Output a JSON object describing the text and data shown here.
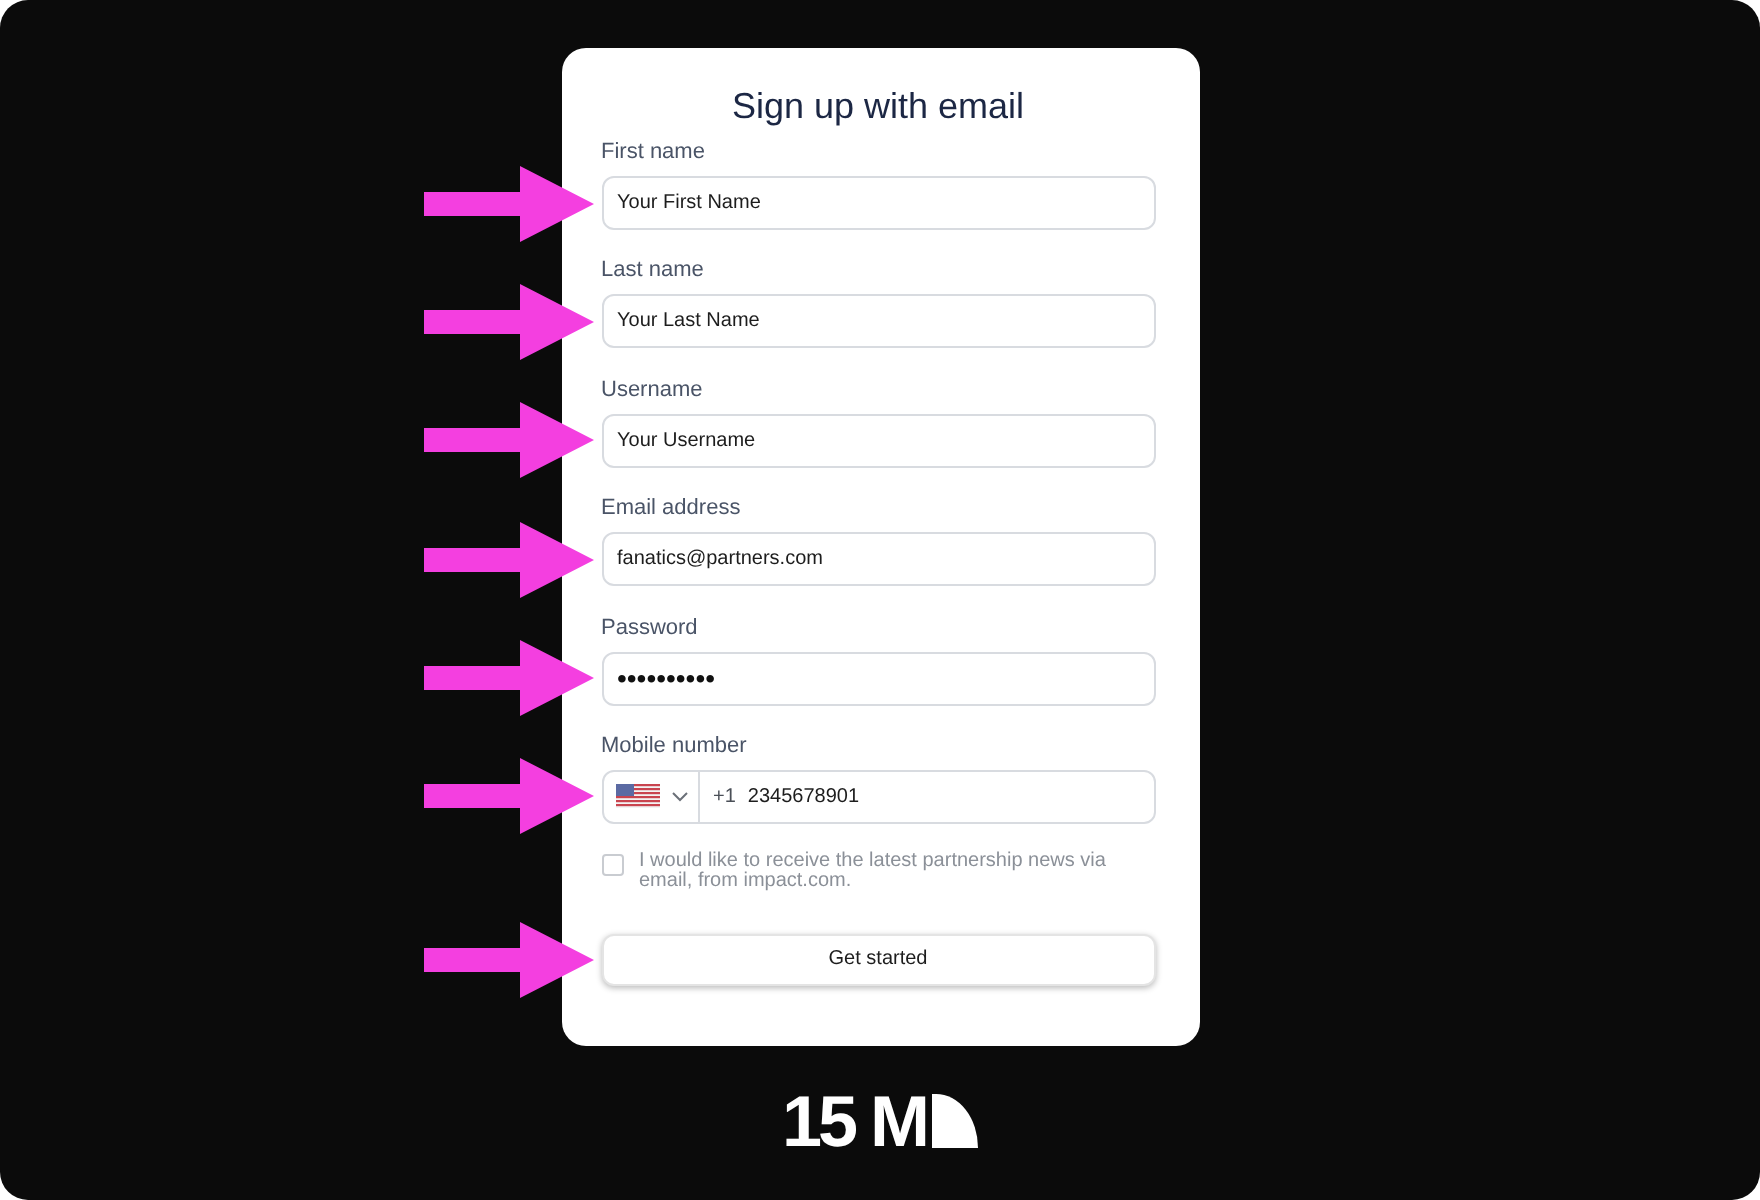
{
  "form": {
    "title": "Sign up with email",
    "fields": [
      {
        "kind": "text",
        "label": "First name",
        "value": "Your First Name",
        "arrow": true
      },
      {
        "kind": "text",
        "label": "Last name",
        "value": "Your Last Name",
        "arrow": true
      },
      {
        "kind": "text",
        "label": "Username",
        "value": "Your Username",
        "arrow": true
      },
      {
        "kind": "email",
        "label": "Email address",
        "value": "fanatics@partners.com",
        "arrow": true
      },
      {
        "kind": "password",
        "label": "Password",
        "value": "••••••••••",
        "arrow": true
      },
      {
        "kind": "phone",
        "label": "Mobile number",
        "dial_code": "+1",
        "value": "2345678901",
        "arrow": true
      }
    ],
    "consent": {
      "checked": false,
      "text": "I would like to receive the latest partnership news via email, from impact.com."
    },
    "button": {
      "label": "Get started",
      "arrow": true
    }
  },
  "logo": {
    "text": "15 M"
  }
}
